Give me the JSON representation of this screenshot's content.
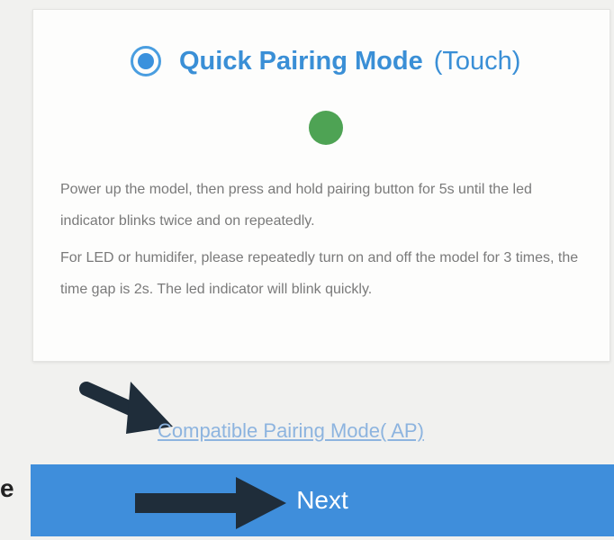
{
  "pairing_card": {
    "mode_title": "Quick Pairing Mode",
    "mode_subtitle": "(Touch)",
    "radio_selected": true,
    "led_color": "#4ea354",
    "instruction_1": "Power up the model, then press and hold pairing button for 5s until the led indicator blinks twice and on repeatedly.",
    "instruction_2": "For LED or humidifer, please repeatedly turn on and off the model for 3 times, the time gap is 2s. The led indicator will blink quickly."
  },
  "compatible_link": "Compatible Pairing Mode( AP)",
  "next_button": "Next",
  "edge_fragment": "e",
  "colors": {
    "accent": "#3a8fd6",
    "button": "#3f8edb",
    "link": "#8db4df",
    "annotation_arrow": "#1f2d3a"
  },
  "icons": [
    "radio-selected-icon",
    "led-indicator-icon",
    "arrow-annotation-icon"
  ]
}
